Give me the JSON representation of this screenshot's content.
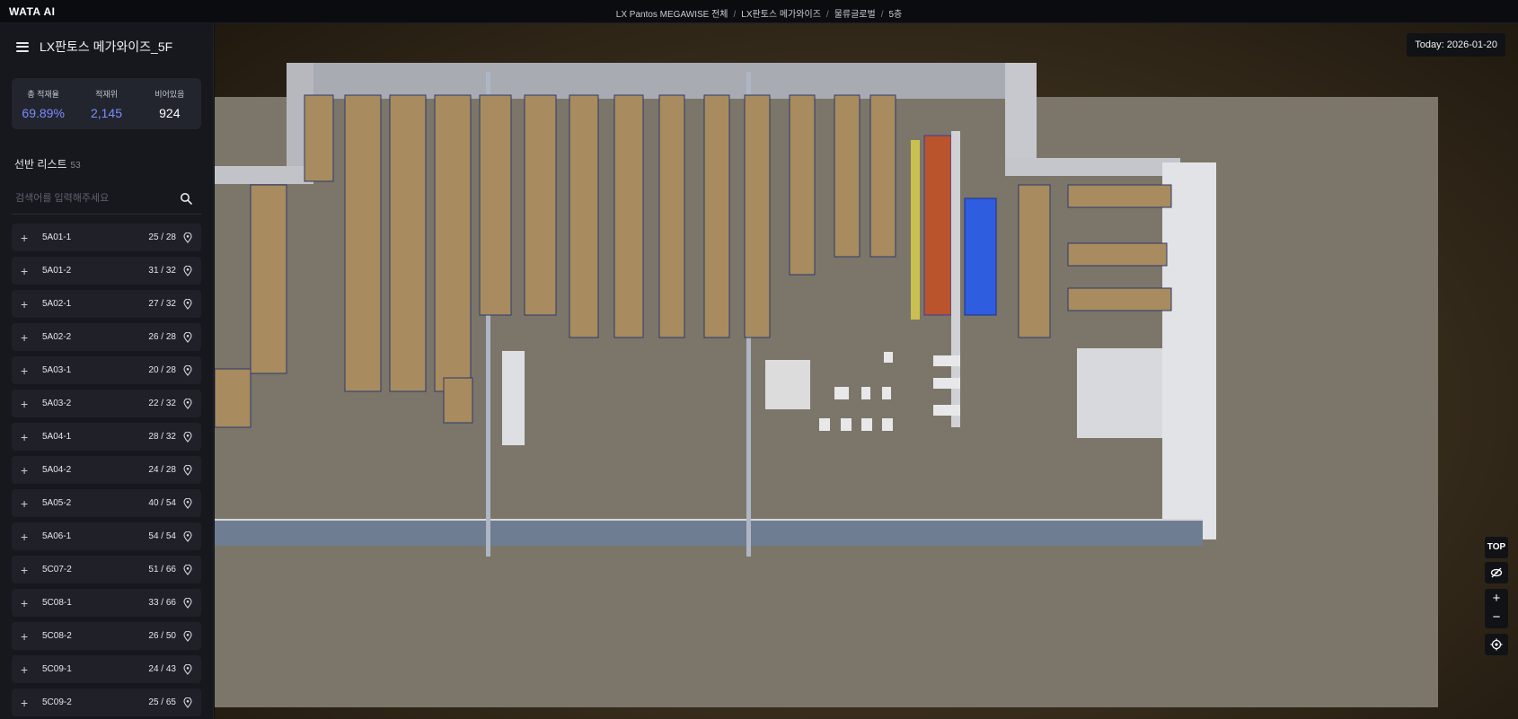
{
  "header": {
    "logo": "WATA AI",
    "breadcrumbs": [
      "LX Pantos MEGAWISE 전체",
      "LX판토스 메가와이즈",
      "물류글로벌",
      "5층"
    ]
  },
  "sidebar": {
    "title": "LX판토스 메가와이즈_5F",
    "stats": [
      {
        "label": "총 적재율",
        "value": "69.89%",
        "color": "#7b8cff"
      },
      {
        "label": "적재위",
        "value": "2,145",
        "color": "#7b8cff"
      },
      {
        "label": "비어있음",
        "value": "924",
        "color": "#ffffff"
      }
    ],
    "section_title": "선반 리스트",
    "section_count": "53",
    "search_placeholder": "검색어를 입력해주세요",
    "items": [
      {
        "name": "5A01-1",
        "count": "25 / 28"
      },
      {
        "name": "5A01-2",
        "count": "31 / 32"
      },
      {
        "name": "5A02-1",
        "count": "27 / 32"
      },
      {
        "name": "5A02-2",
        "count": "26 / 28"
      },
      {
        "name": "5A03-1",
        "count": "20 / 28"
      },
      {
        "name": "5A03-2",
        "count": "22 / 32"
      },
      {
        "name": "5A04-1",
        "count": "28 / 32"
      },
      {
        "name": "5A04-2",
        "count": "24 / 28"
      },
      {
        "name": "5A05-2",
        "count": "40 / 54"
      },
      {
        "name": "5A06-1",
        "count": "54 / 54"
      },
      {
        "name": "5C07-2",
        "count": "51 / 66"
      },
      {
        "name": "5C08-1",
        "count": "33 / 66"
      },
      {
        "name": "5C08-2",
        "count": "26 / 50"
      },
      {
        "name": "5C09-1",
        "count": "24 / 43"
      },
      {
        "name": "5C09-2",
        "count": "25 / 65"
      }
    ]
  },
  "viewport": {
    "today_label": "Today: 2026-01-20",
    "top_button": "TOP",
    "zoom_in": "+",
    "zoom_out": "−"
  }
}
